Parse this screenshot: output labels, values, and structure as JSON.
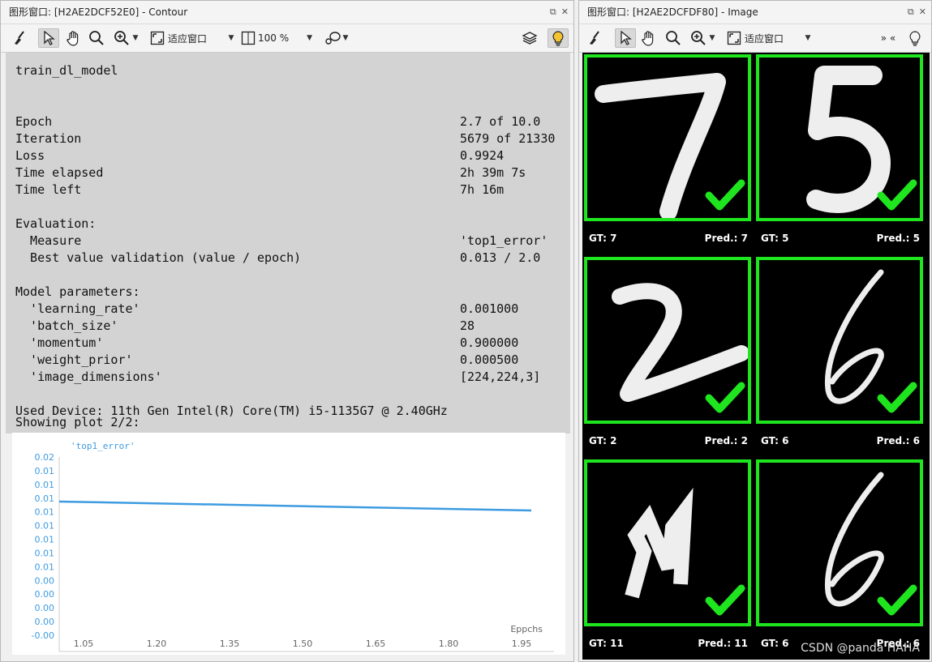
{
  "left_window": {
    "title": "图形窗口: [H2AE2DCF52E0] - Contour",
    "toolbar": {
      "fit_label": "适应窗口",
      "zoom_label": "100 %"
    },
    "heading": "train_dl_model",
    "stats": [
      {
        "label": "Epoch",
        "value": "2.7 of 10.0"
      },
      {
        "label": "Iteration",
        "value": "5679 of 21330"
      },
      {
        "label": "Loss",
        "value": "0.9924"
      },
      {
        "label": "Time elapsed",
        "value": "2h 39m 7s"
      },
      {
        "label": "Time left",
        "value": "7h 16m"
      }
    ],
    "evaluation_header": "Evaluation:",
    "evaluation": [
      {
        "label": "  Measure",
        "value": "'top1_error'"
      },
      {
        "label": "  Best value validation (value / epoch)",
        "value": "0.013 / 2.0"
      }
    ],
    "params_header": "Model parameters:",
    "params": [
      {
        "label": "  'learning_rate'",
        "value": "0.001000"
      },
      {
        "label": "  'batch_size'",
        "value": "28"
      },
      {
        "label": "  'momentum'",
        "value": "0.900000"
      },
      {
        "label": "  'weight_prior'",
        "value": "0.000500"
      },
      {
        "label": "  'image_dimensions'",
        "value": "[224,224,3]"
      }
    ],
    "device": "Used Device: 11th Gen Intel(R) Core(TM) i5-1135G7 @ 2.40GHz",
    "showing_plot": "Showing plot 2/2:"
  },
  "chart_data": {
    "type": "line",
    "legend": "'top1_error'",
    "xlabel": "Eppchs",
    "xticks": [
      "1.05",
      "1.20",
      "1.35",
      "1.50",
      "1.65",
      "1.80",
      "1.95"
    ],
    "xtick_values": [
      1.05,
      1.2,
      1.35,
      1.5,
      1.65,
      1.8,
      1.95
    ],
    "yticks": [
      "0.02",
      "0.01",
      "0.01",
      "0.01",
      "0.01",
      "0.01",
      "0.01",
      "0.01",
      "0.01",
      "0.00",
      "0.00",
      "0.00",
      "0.00",
      "-0.00"
    ],
    "xlim": [
      1.0,
      2.0
    ],
    "ylim": [
      -0.0005,
      0.0195
    ],
    "series": [
      {
        "name": "'top1_error'",
        "color": "#3d9be0",
        "x": [
          1.0,
          1.97
        ],
        "y": [
          0.0145,
          0.0135
        ]
      }
    ],
    "grid": true
  },
  "right_window": {
    "title": "图形窗口: [H2AE2DCFDF80] - Image",
    "toolbar": {
      "fit_label": "适应窗口",
      "nav_label": "» «"
    },
    "items": [
      {
        "gt": "GT: 7",
        "pred": "Pred.: 7",
        "digit": "7"
      },
      {
        "gt": "GT: 5",
        "pred": "Pred.: 5",
        "digit": "5"
      },
      {
        "gt": "GT: 2",
        "pred": "Pred.: 2",
        "digit": "2"
      },
      {
        "gt": "GT: 6",
        "pred": "Pred.: 6",
        "digit": "6"
      },
      {
        "gt": "GT: 11",
        "pred": "Pred.: 11",
        "digit": "N"
      },
      {
        "gt": "GT: 6",
        "pred": "Pred.: 6",
        "digit": "6"
      }
    ],
    "watermark": "CSDN @panda HAHA"
  },
  "colors": {
    "frame": "#1fe51f",
    "check": "#1fe51f",
    "plot_line": "#3d9be0",
    "tick_text": "#3d9be0"
  }
}
